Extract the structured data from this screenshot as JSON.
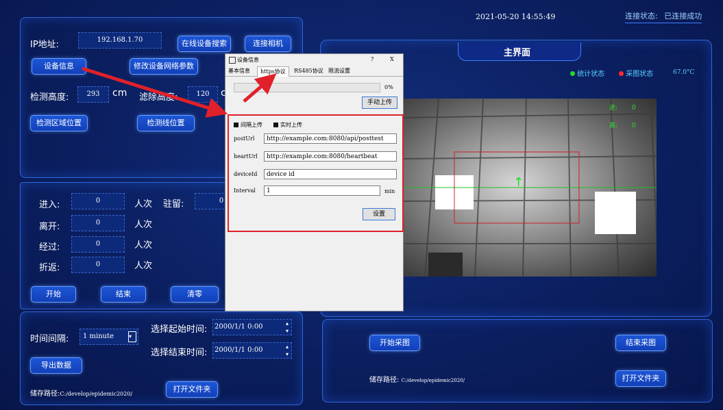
{
  "header": {
    "datetime": "2021-05-20 14:55:49",
    "connection_label": "连接状态:",
    "connection_value": "已连接成功",
    "main_title": "主界面"
  },
  "status": {
    "stats_label": "统计状态",
    "stats_color": "#2bd62b",
    "capture_label": "采图状态",
    "capture_color": "#ff2a2a",
    "temperature": "67.0°C"
  },
  "left": {
    "ip_label": "IP地址:",
    "ip_value": "192.168.1.70",
    "search_btn": "在线设备搜索",
    "connect_btn": "连接相机",
    "device_info_btn": "设备信息",
    "modify_net_btn": "修改设备网络参数",
    "detect_height_label": "检测高度:",
    "detect_height_value": "293",
    "unit_cm": "cm",
    "filter_height_label": "滤除高度:",
    "filter_height_value": "120",
    "unit_c": "c",
    "area_btn": "检测区域位置",
    "line_btn": "检测线位置"
  },
  "counts": {
    "enter_label": "进入:",
    "enter_value": "0",
    "leave_label": "离开:",
    "leave_value": "0",
    "pass_label": "经过:",
    "pass_value": "0",
    "turn_label": "折返:",
    "turn_value": "0",
    "unit": "人次",
    "stay_label": "驻留:",
    "stay_value": "0",
    "start_btn": "开始",
    "end_btn": "结束",
    "clear_btn": "清零"
  },
  "export": {
    "interval_label": "时间间隔:",
    "interval_value": "1 minute",
    "start_time_label": "选择起始时间:",
    "start_time_value": "2000/1/1 0:00",
    "end_time_label": "选择结束时间:",
    "end_time_value": "2000/1/1 0:00",
    "export_btn": "导出数据",
    "path_label": "储存路径:",
    "path_value": "C:/develop/epidemic2020/",
    "open_folder_btn": "打开文件夹"
  },
  "right": {
    "start_capture_btn": "开始采图",
    "end_capture_btn": "结束采图",
    "path_label": "储存路径:",
    "path_value": "C:/develop/epidemic2020/",
    "open_folder_btn": "打开文件夹",
    "overlay_in_label": "进:",
    "overlay_in_value": "0",
    "overlay_out_label": "离:",
    "overlay_out_value": "0"
  },
  "dialog": {
    "title": "设备信息",
    "help": "?",
    "close": "X",
    "tabs": [
      "基本信息",
      "https协议",
      "RS485协议",
      "限流设置"
    ],
    "progress_percent": 0,
    "progress_text": "0%",
    "manual_upload_btn": "手动上传",
    "interval_upload_label": "间隔上传",
    "realtime_upload_label": "实时上传",
    "post_url_label": "postUrl",
    "post_url_value": "http://example.com:8080/api/posttest",
    "heart_url_label": "heartUrl",
    "heart_url_value": "http://example.com:8080/heartbeat",
    "device_id_label": "deviceId",
    "device_id_value": "device id",
    "interval_label": "Interval",
    "interval_value": "1",
    "interval_unit": "min",
    "set_btn": "设置"
  },
  "colors": {
    "accent": "#1d56d6",
    "highlight": "#e0202a"
  }
}
